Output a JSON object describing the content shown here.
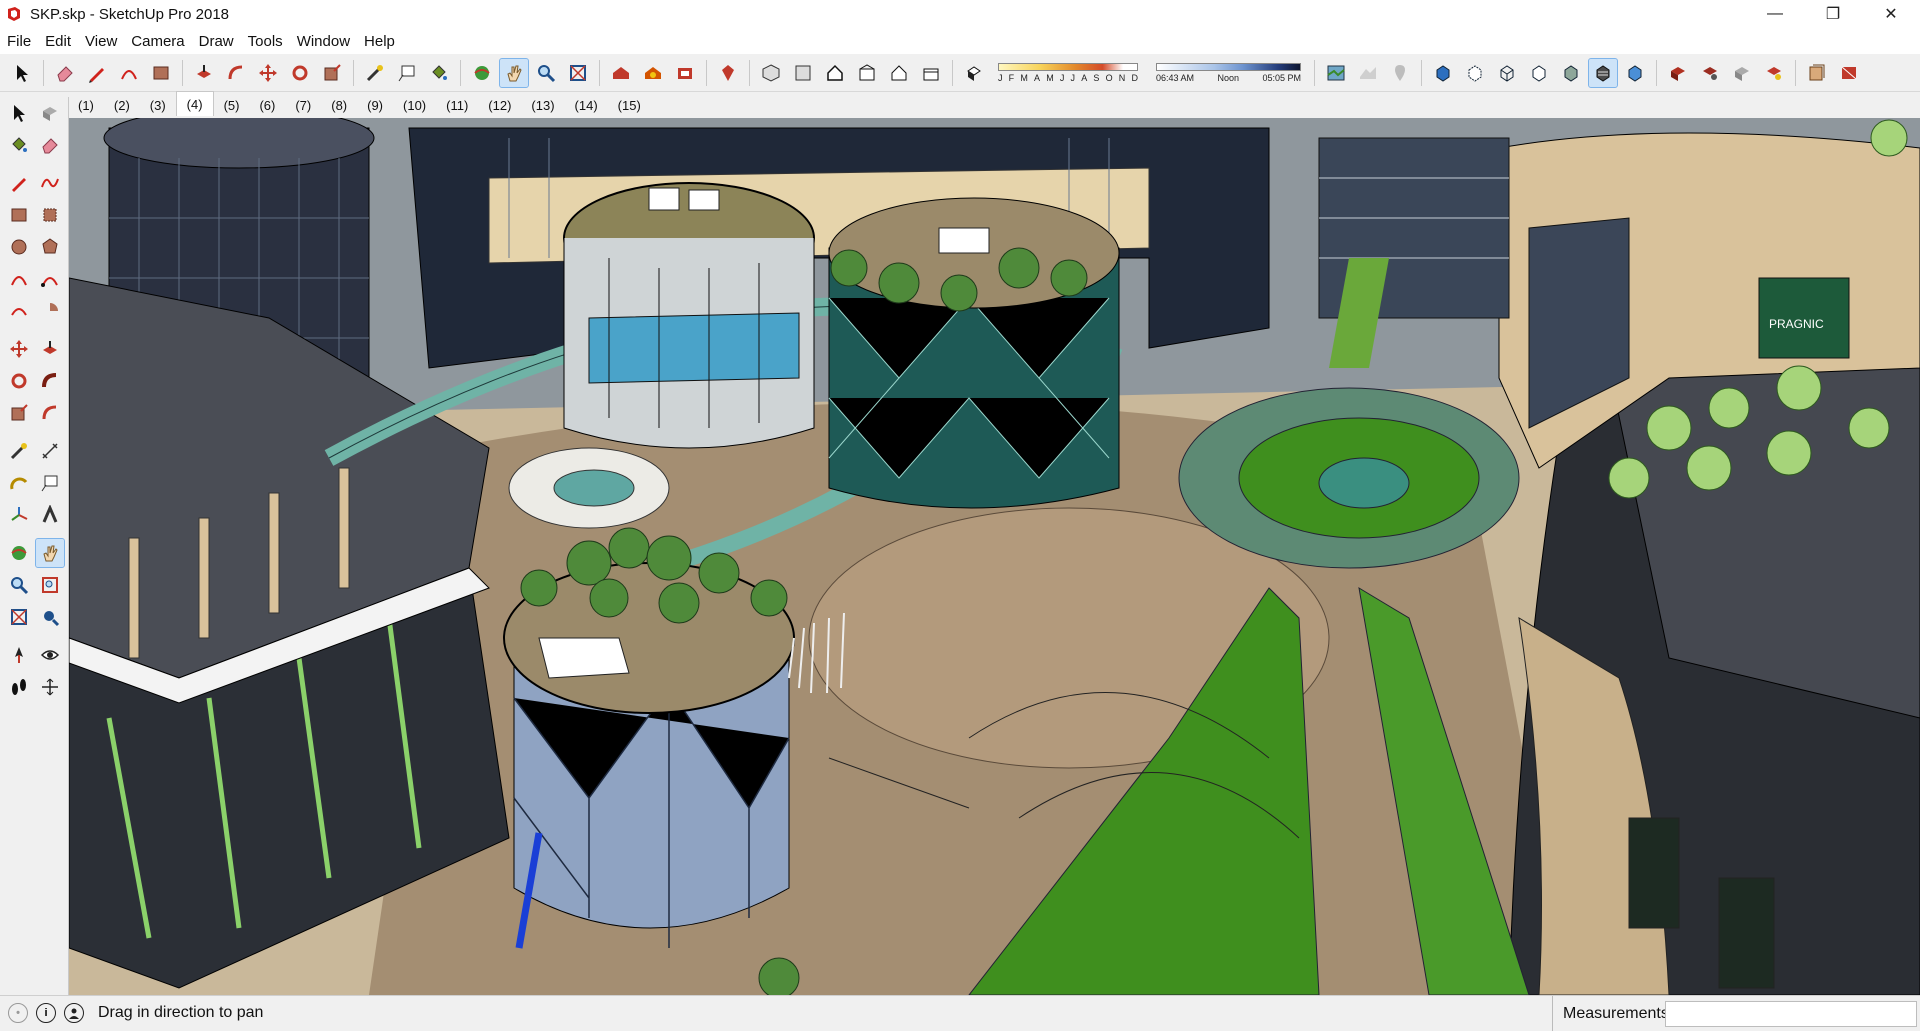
{
  "window": {
    "title": "SKP.skp - SketchUp Pro 2018",
    "minimize": "—",
    "maximize": "❐",
    "close": "✕"
  },
  "menu": [
    "File",
    "Edit",
    "View",
    "Camera",
    "Draw",
    "Tools",
    "Window",
    "Help"
  ],
  "shadows": {
    "months": [
      "J",
      "F",
      "M",
      "A",
      "M",
      "J",
      "J",
      "A",
      "S",
      "O",
      "N",
      "D"
    ],
    "time_start": "06:43 AM",
    "time_mid": "Noon",
    "time_end": "05:05 PM"
  },
  "scenes": {
    "tabs": [
      "(1)",
      "(2)",
      "(3)",
      "(4)",
      "(5)",
      "(6)",
      "(7)",
      "(8)",
      "(9)",
      "(10)",
      "(11)",
      "(12)",
      "(13)",
      "(14)",
      "(15)"
    ],
    "active": "(4)"
  },
  "status": {
    "hint": "Drag in direction to pan",
    "measurements_label": "Measurements",
    "measurements_value": "",
    "info_icon": "i"
  },
  "model": {
    "sign_text": "PRAGNIC"
  },
  "colors": {
    "accent": "#c8201a",
    "select_blue": "#cde3f8",
    "lawn": "#3f8f1e",
    "glass": "#5fa7a2",
    "paving": "#a48e72"
  }
}
